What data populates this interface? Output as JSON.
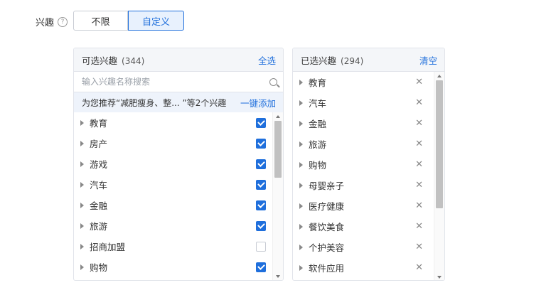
{
  "interest_field": {
    "label": "兴趣",
    "options": [
      "不限",
      "自定义"
    ],
    "selected": "自定义"
  },
  "available": {
    "title": "可选兴趣",
    "count": "(344)",
    "action": "全选",
    "search_placeholder": "输入兴趣名称搜索",
    "recommend_text": "为您推荐“减肥瘦身、整... ”等2个兴趣",
    "recommend_action": "一键添加",
    "items": [
      {
        "label": "教育",
        "checked": true
      },
      {
        "label": "房产",
        "checked": true
      },
      {
        "label": "游戏",
        "checked": true
      },
      {
        "label": "汽车",
        "checked": true
      },
      {
        "label": "金融",
        "checked": true
      },
      {
        "label": "旅游",
        "checked": true
      },
      {
        "label": "招商加盟",
        "checked": false
      },
      {
        "label": "购物",
        "checked": true
      }
    ]
  },
  "selected": {
    "title": "已选兴趣",
    "count": "(294)",
    "action": "清空",
    "items": [
      "教育",
      "汽车",
      "金融",
      "旅游",
      "购物",
      "母婴亲子",
      "医疗健康",
      "餐饮美食",
      "个护美容",
      "软件应用"
    ]
  },
  "colors": {
    "accent": "#1f6fdc",
    "header_bg": "#f4f6f9",
    "recommend_bg": "#eef3fb"
  }
}
